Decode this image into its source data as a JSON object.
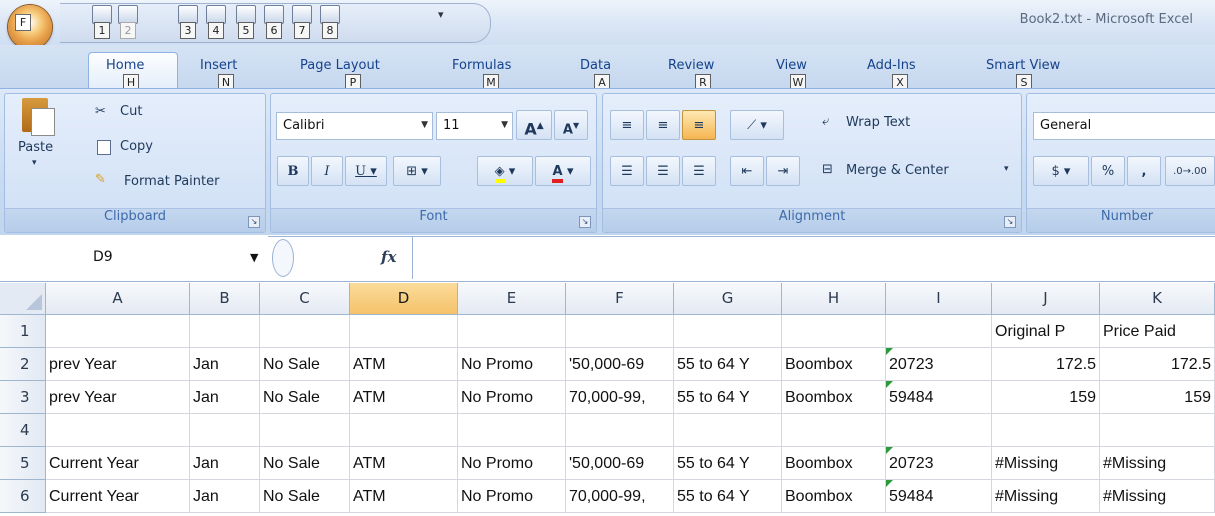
{
  "window": {
    "title": "Book2.txt - Microsoft Excel"
  },
  "office_button": {
    "keytip": "F"
  },
  "quick_access": {
    "items": [
      {
        "name": "save-icon",
        "keytip": "1"
      },
      {
        "name": "undo-icon",
        "keytip": "2"
      },
      {
        "name": "print-preview-icon",
        "keytip": "3"
      },
      {
        "name": "print-icon",
        "keytip": "4"
      },
      {
        "name": "copy-doc-icon",
        "keytip": "5"
      },
      {
        "name": "open-icon",
        "keytip": "6"
      },
      {
        "name": "spell-icon",
        "keytip": "7"
      },
      {
        "name": "undo-history-icon",
        "keytip": "8"
      }
    ],
    "more": "▾"
  },
  "tabs": [
    {
      "label": "Home",
      "keytip": "H",
      "active": true
    },
    {
      "label": "Insert",
      "keytip": "N"
    },
    {
      "label": "Page Layout",
      "keytip": "P"
    },
    {
      "label": "Formulas",
      "keytip": "M"
    },
    {
      "label": "Data",
      "keytip": "A"
    },
    {
      "label": "Review",
      "keytip": "R"
    },
    {
      "label": "View",
      "keytip": "W"
    },
    {
      "label": "Add-Ins",
      "keytip": "X"
    },
    {
      "label": "Smart View",
      "keytip": "S"
    }
  ],
  "ribbon": {
    "clipboard": {
      "label": "Clipboard",
      "paste": "Paste",
      "cut": "Cut",
      "copy": "Copy",
      "format_painter": "Format Painter"
    },
    "font": {
      "label": "Font",
      "name": "Calibri",
      "size": "11",
      "bold": "B",
      "italic": "I",
      "underline": "U",
      "grow": "A",
      "shrink": "A",
      "color": "A"
    },
    "alignment": {
      "label": "Alignment",
      "wrap": "Wrap Text",
      "merge": "Merge & Center"
    },
    "number": {
      "label": "Number",
      "format": "General",
      "percent": "%",
      "comma": ","
    }
  },
  "formula_bar": {
    "namebox": "D9",
    "fx": "fx",
    "value": ""
  },
  "columns": [
    "A",
    "B",
    "C",
    "D",
    "E",
    "F",
    "G",
    "H",
    "I",
    "J",
    "K"
  ],
  "selected_column": "D",
  "rows": [
    {
      "num": "1",
      "cells": [
        "",
        "",
        "",
        "",
        "",
        "",
        "",
        "",
        "",
        "Original P",
        "Price Paid"
      ]
    },
    {
      "num": "2",
      "cells": [
        "prev Year",
        "Jan",
        "No Sale",
        "ATM",
        "No Promo",
        "'50,000-69",
        "55 to 64 Y",
        "Boombox",
        "20723",
        "172.5",
        "172.5"
      ]
    },
    {
      "num": "3",
      "cells": [
        "prev Year",
        "Jan",
        "No Sale",
        "ATM",
        "No Promo",
        "70,000-99,",
        "55 to 64 Y",
        "Boombox",
        "59484",
        "159",
        "159"
      ]
    },
    {
      "num": "4",
      "cells": [
        "",
        "",
        "",
        "",
        "",
        "",
        "",
        "",
        "",
        "",
        ""
      ]
    },
    {
      "num": "5",
      "cells": [
        "Current Year",
        "Jan",
        "No Sale",
        "ATM",
        "No Promo",
        "'50,000-69",
        "55 to 64 Y",
        "Boombox",
        "20723",
        "#Missing",
        "#Missing"
      ]
    },
    {
      "num": "6",
      "cells": [
        "Current Year",
        "Jan",
        "No Sale",
        "ATM",
        "No Promo",
        "70,000-99,",
        "55 to 64 Y",
        "Boombox",
        "59484",
        "#Missing",
        "#Missing"
      ]
    }
  ],
  "colors": {
    "ribbon": "#c8dbf1",
    "selected_header": "#f5c26a",
    "text_indicator": "#2c9a3a"
  }
}
